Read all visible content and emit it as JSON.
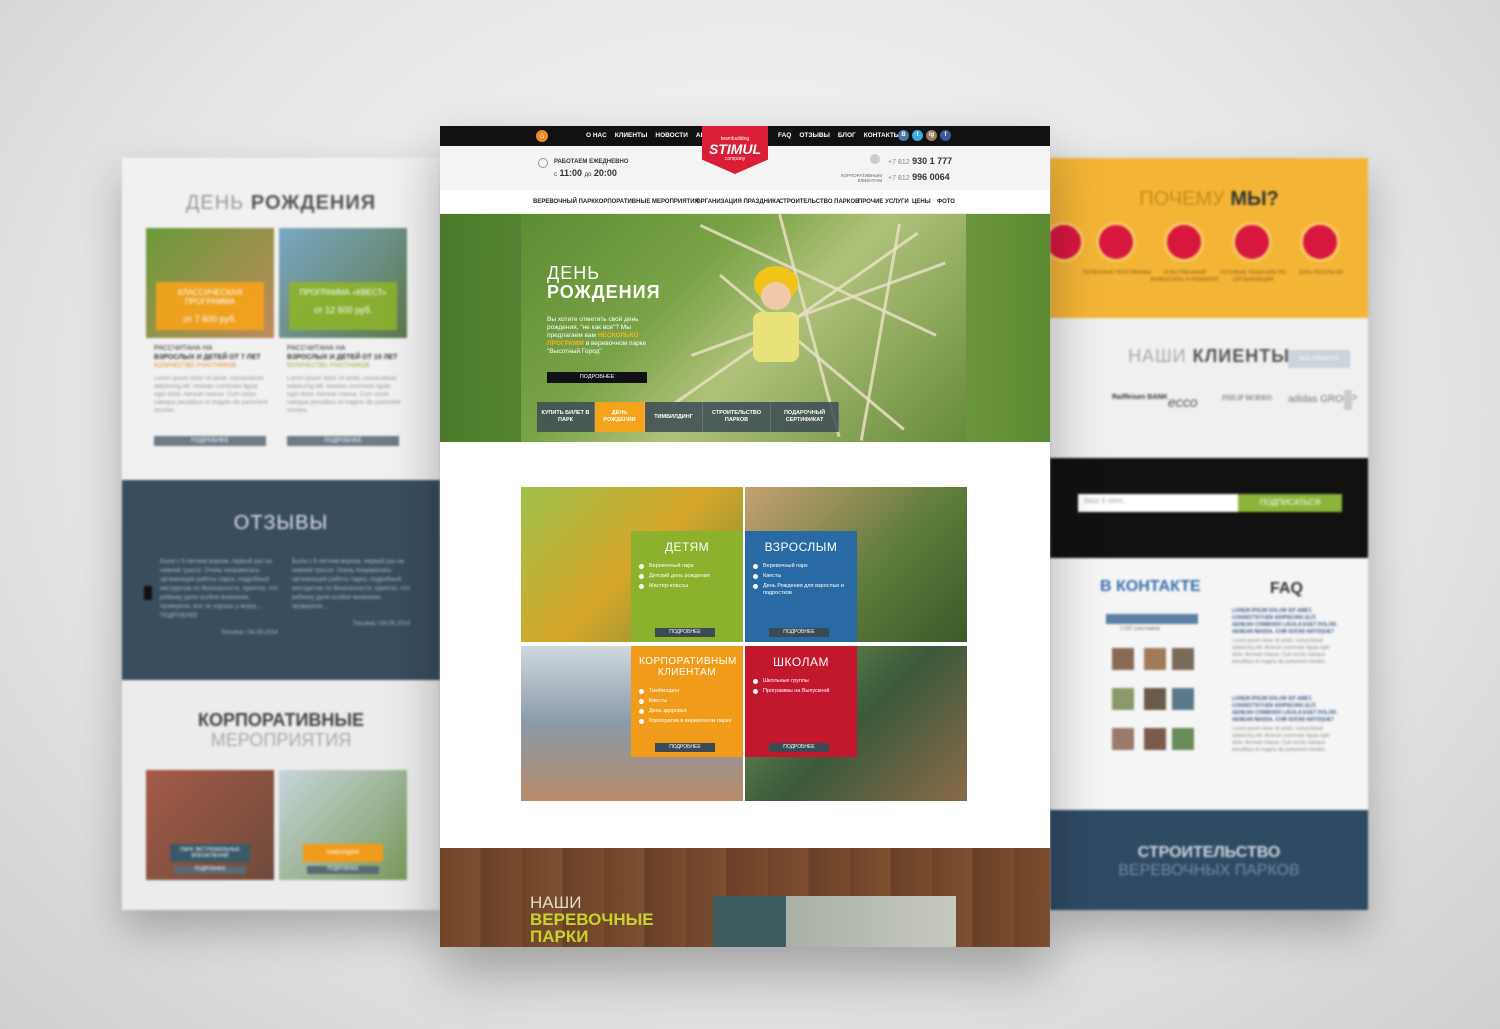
{
  "left_page": {
    "birthday_title_light": "ДЕНЬ",
    "birthday_title_bold": "РОЖДЕНИЯ",
    "cards": [
      {
        "badge": "КЛАССИЧЕСКАЯ ПРОГРАММА",
        "price": "от 7 600 руб.",
        "subtitle": "РАССЧИТАНА НА",
        "subtitle_bold": "ВЗРОСЛЫХ И ДЕТЕЙ ОТ 7 ЛЕТ",
        "note": "КОЛИЧЕСТВО УЧАСТНИКОВ",
        "text": "Lorem ipsum dolor sit amet, consectetuer adipiscing elit. Aenean commodo ligula eget dolor. Aenean massa. Cum sociis natoque penatibus et magnis dis parturient montes.",
        "button": "ПОДРОБНЕЕ"
      },
      {
        "badge": "ПРОГРАММА «КВЕСТ»",
        "price": "от 12 600 руб.",
        "subtitle": "РАССЧИТАНА НА",
        "subtitle_bold": "ВЗРОСЛЫХ И ДЕТЕЙ ОТ 10 ЛЕТ",
        "note": "КОЛИЧЕСТВО УЧАСТНИКОВ",
        "text": "Lorem ipsum dolor sit amet, consectetuer adipiscing elit. Aenean commodo ligula eget dolor. Aenean massa. Cum sociis natoque penatibus et magnis dis parturient montes.",
        "button": "ПОДРОБНЕЕ"
      }
    ],
    "reviews_title": "ОТЗЫВЫ",
    "reviews": [
      {
        "text": "Были с 5-летним внуком, первый раз на нижней трассе. Очень понравилась организация работы парка, подробный инструктаж по безопасности, приятно, что ребенку дали особое внимание, проверили, все ли хорошо у внука... ПОДРОБНЕЕ",
        "author": "Татьяна / 04.09.2014"
      },
      {
        "text": "Были с 5-летним внуком, первый раз на нижней трассе. Очень понравилась организация работы парка, подробный инструктаж по безопасности, приятно, что ребенку дали особое внимание, проверили...",
        "author": "Татьяна / 04.09.2014"
      }
    ],
    "corp_title_bold": "КОРПОРАТИВНЫЕ",
    "corp_title_light": "МЕРОПРИЯТИЯ",
    "corp_badges": [
      "ПАРК ЭКСТРЕМАЛЬНЫХ ВПЕЧАТЛЕНИЙ",
      "ТИМБИЛДИНГ"
    ],
    "corp_button": "ПОДРОБНЕЕ"
  },
  "right_page": {
    "why_light": "ПОЧЕМУ",
    "why_bold": "МЫ?",
    "features": [
      "ПОЛЕЗНЫЕ ПРОГРАММЫ",
      "СОБСТВЕННЫЙ ИНВЕНТАРЬ И РЕКВИЗИТ",
      "ГОТОВЫЕ РЕШЕНИЯ ПО ОРГАНИЗАЦИИ",
      "100% РЕЗУЛЬТАТ"
    ],
    "clients_light": "НАШИ",
    "clients_bold": "КЛИЕНТЫ",
    "all_clients": "ВСЕ КЛИЕНТЫ",
    "client_logos": [
      "Raiffeisen BANK",
      "ecco",
      "PHILIP MORRIS",
      "adidas GROUP"
    ],
    "subscribe_placeholder": "ВАШ E-MAIL",
    "subscribe_button": "ПОДПИСАТЬСЯ",
    "vk_title": "В КОНТАКТЕ",
    "vk_members": "1 037 участников",
    "faq_title": "FAQ",
    "faq_items": [
      {
        "q": "LOREM IPSUM DOLOR SIT AMET, CONSECTETUER ADIPISCING ELIT. AENEAN COMMODO LIGULA EGET DOLOR. AENEAN MASSA. CUM SOCIIS NATOQUE?",
        "a": "Lorem ipsum dolor sit amet, consectetuer adipiscing elit. Aenean commodo ligula eget dolor. Aenean massa. Cum sociis natoque penatibus et magnis dis parturient montes."
      },
      {
        "q": "LOREM IPSUM DOLOR SIT AMET, CONSECTETUER ADIPISCING ELIT. AENEAN COMMODO LIGULA EGET DOLOR. AENEAN MASSA. CUM SOCIIS NATOQUE?",
        "a": "Lorem ipsum dolor sit amet, consectetuer adipiscing elit. Aenean commodo ligula eget dolor. Aenean massa. Cum sociis natoque penatibus et magnis dis parturient montes."
      }
    ],
    "construction_bold": "СТРОИТЕЛЬСТВО",
    "construction_light": "ВЕРЕВОЧНЫХ ПАРКОВ"
  },
  "main": {
    "top_nav_left": [
      "О НАС",
      "КЛИЕНТЫ",
      "НОВОСТИ",
      "АКЦИИ"
    ],
    "top_nav_right": [
      "FAQ",
      "ОТЗЫВЫ",
      "БЛОГ",
      "КОНТАКТЫ"
    ],
    "social": [
      "В",
      "t",
      "ig",
      "f"
    ],
    "logo_top": "teambuilding",
    "logo_name": "STIMUL",
    "logo_bottom": "company",
    "schedule_label": "РАБОТАЕМ ЕЖЕДНЕВНО",
    "schedule_from": "с",
    "schedule_from_time": "11:00",
    "schedule_to": "до",
    "schedule_to_time": "20:00",
    "phone1_prefix": "+7 812",
    "phone1": "930 1 777",
    "phone2_label": "КОРПОРАТИВНЫМ КЛИЕНТАМ",
    "phone2_prefix": "+7 812",
    "phone2": "996 0064",
    "menu": [
      "ВЕРЕВОЧНЫЙ ПАРК",
      "КОРПОРАТИВНЫЕ МЕРОПРИЯТИЯ",
      "ОРГАНИЗАЦИЯ ПРАЗДНИКА",
      "СТРОИТЕЛЬСТВО ПАРКОВ",
      "ПРОЧИЕ УСЛУГИ",
      "ЦЕНЫ",
      "ФОТО"
    ],
    "hero": {
      "title_light": "ДЕНЬ",
      "title_bold": "РОЖДЕНИЯ",
      "text_a": "Вы хотите отметить свой день рождения, \"не как все\"? Мы предлагаем вам",
      "text_highlight": "НЕСКОЛЬКО ПРОГРАММ",
      "text_b": "в веревочном парке \"Высотный Город\"",
      "button": "ПОДРОБНЕЕ",
      "tabs": [
        "КУПИТЬ БИЛЕТ В ПАРК",
        "ДЕНЬ РОЖДЕНИЯ",
        "ТИМБИЛДИНГ",
        "СТРОИТЕЛЬСТВО ПАРКОВ",
        "ПОДАРОЧНЫЙ СЕРТИФИКАТ"
      ]
    },
    "tiles": [
      {
        "title": "ДЕТЯМ",
        "items": [
          "Веревочный парк",
          "Детский день рождения",
          "Мастер-классы"
        ],
        "button": "ПОДРОБНЕЕ",
        "color": "#8cb22d"
      },
      {
        "title": "ВЗРОСЛЫМ",
        "items": [
          "Веревочный парк",
          "Квесты",
          "День Рождения для взрослых и подростков"
        ],
        "button": "ПОДРОБНЕЕ",
        "color": "#2a6aa4"
      },
      {
        "title": "КОРПОРАТИВНЫМ КЛИЕНТАМ",
        "items": [
          "Тимбилдинг",
          "Квесты",
          "День здоровья",
          "Корпоратив в веревочном парке"
        ],
        "button": "ПОДРОБНЕЕ",
        "color": "#f09c1a"
      },
      {
        "title": "ШКОЛАМ",
        "items": [
          "Школьные группы",
          "Программы на Выпускной"
        ],
        "button": "ПОДРОБНЕЕ",
        "color": "#c3172e"
      }
    ],
    "parks_light": "НАШИ",
    "parks_bold_1": "ВЕРЕВОЧНЫЕ",
    "parks_bold_2": "ПАРКИ"
  }
}
